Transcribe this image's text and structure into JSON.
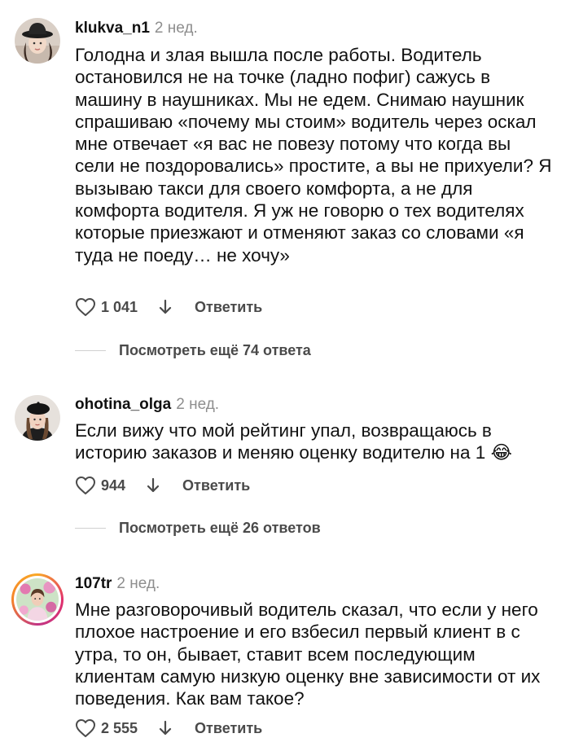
{
  "comments": [
    {
      "username": "klukva_n1",
      "time": "2 нед.",
      "text": "Голодна и злая вышла после работы. Водитель остановился не на точке (ладно пофиг) сажусь в машину в наушниках. Мы не едем. Снимаю наушник спрашиваю «почему мы стоим» водитель через оскал мне отвечает «я вас не повезу потому что когда вы сели не поздоровались» простите, а вы не прихуели? Я вызываю такси для своего комфорта, а не для комфорта водителя. Я уж не говорю о тех водителях которые приезжают и отменяют заказ со словами «я туда не поеду… не хочу»",
      "likes": "1 041",
      "reply_label": "Ответить",
      "view_replies": "Посмотреть ещё 74 ответа",
      "avatar_icon": "user-avatar-hat"
    },
    {
      "username": "ohotina_olga",
      "time": "2 нед.",
      "text": "Если вижу что мой рейтинг упал, возвращаюсь в историю заказов и меняю оценку водителю на 1 😂",
      "likes": "944",
      "reply_label": "Ответить",
      "view_replies": "Посмотреть ещё 26 ответов",
      "avatar_icon": "user-avatar-beret"
    },
    {
      "username": "107tr",
      "time": "2 нед.",
      "text": "Мне разговорочивый водитель сказал, что если у него плохое настроение и его взбесил первый клиент в с утра, то он, бывает, ставит всем последующим клиентам самую низкую оценку вне зависимости от их поведения. Как вам такое?",
      "likes": "2 555",
      "reply_label": "Ответить",
      "avatar_icon": "user-avatar-flowers"
    }
  ],
  "colors": {
    "text": "#111111",
    "muted": "#8e8e8e",
    "action": "#4a4a4a",
    "story_ring": "#e1306c"
  }
}
